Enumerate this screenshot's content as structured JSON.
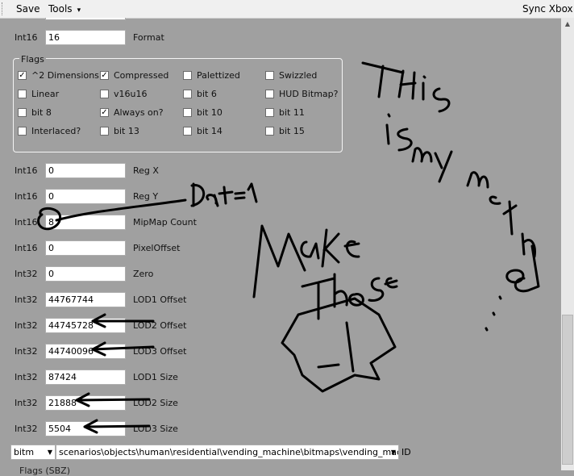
{
  "menubar": {
    "save": "Save",
    "tools": "Tools",
    "tools_arrow": "▾",
    "sync": "Sync Xbox"
  },
  "fields_top": [
    {
      "type": "Int16",
      "value": "16",
      "name": "Format"
    }
  ],
  "flags": {
    "title": "Flags",
    "items": [
      {
        "label": "^2 Dimensions",
        "checked": true
      },
      {
        "label": "Compressed",
        "checked": true
      },
      {
        "label": "Palettized",
        "checked": false
      },
      {
        "label": "Swizzled",
        "checked": false
      },
      {
        "label": "Linear",
        "checked": false
      },
      {
        "label": "v16u16",
        "checked": false
      },
      {
        "label": "bit 6",
        "checked": false
      },
      {
        "label": "HUD Bitmap?",
        "checked": false
      },
      {
        "label": "bit 8",
        "checked": false
      },
      {
        "label": "Always on?",
        "checked": true
      },
      {
        "label": "bit 10",
        "checked": false
      },
      {
        "label": "bit 11",
        "checked": false
      },
      {
        "label": "Interlaced?",
        "checked": false
      },
      {
        "label": "bit 13",
        "checked": false
      },
      {
        "label": "bit 14",
        "checked": false
      },
      {
        "label": "bit 15",
        "checked": false
      }
    ]
  },
  "fields": [
    {
      "type": "Int16",
      "value": "0",
      "name": "Reg X"
    },
    {
      "type": "Int16",
      "value": "0",
      "name": "Reg Y"
    },
    {
      "type": "Int16",
      "value": "8",
      "name": "MipMap Count"
    },
    {
      "type": "Int16",
      "value": "0",
      "name": "PixelOffset"
    },
    {
      "type": "Int32",
      "value": "0",
      "name": "Zero"
    },
    {
      "type": "Int32",
      "value": "44767744",
      "name": "LOD1 Offset"
    },
    {
      "type": "Int32",
      "value": "44745728",
      "name": "LOD2 Offset"
    },
    {
      "type": "Int32",
      "value": "44740096",
      "name": "LOD3 Offset"
    },
    {
      "type": "Int32",
      "value": "87424",
      "name": "LOD1 Size"
    },
    {
      "type": "Int32",
      "value": "21888",
      "name": "LOD2 Size"
    },
    {
      "type": "Int32",
      "value": "5504",
      "name": "LOD3 Size"
    }
  ],
  "tag_ref": {
    "tag_class": "bitm",
    "path": "scenarios\\objects\\human\\residential\\vending_machine\\bitmaps\\vending_machine",
    "id_label": "ID"
  },
  "bottom_cut_label": "Flags (SBZ)",
  "annotations": {
    "dat_note": "Dat=1",
    "side_text": "This is my method...",
    "make_those": "Make Those",
    "minus_one": "-1",
    "ink_color": "#000000"
  }
}
